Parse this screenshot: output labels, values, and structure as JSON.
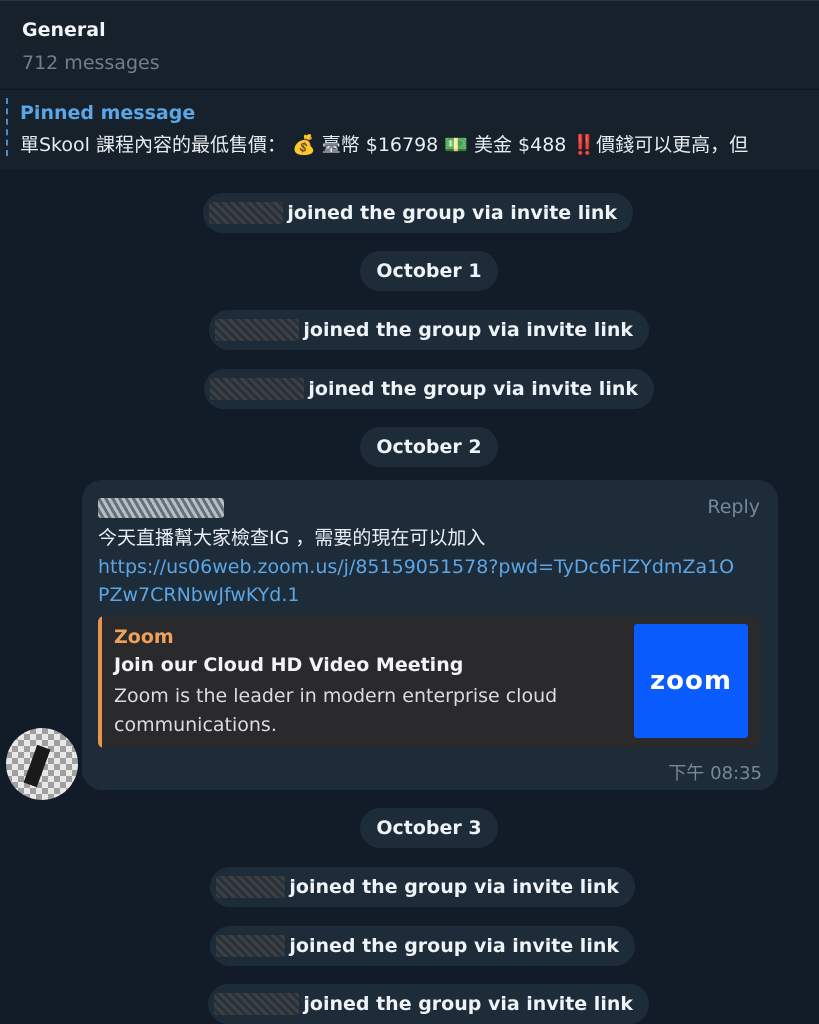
{
  "header": {
    "title": "General",
    "subtitle": "712 messages"
  },
  "pinned": {
    "label": "Pinned message",
    "text": "單Skool 課程內容的最低售價： 💰 臺幣 $16798 💵 美金 $488  ‼️價錢可以更高，但"
  },
  "join_text": "joined the group via invite link",
  "dates": {
    "d1": "October 1",
    "d2": "October 2",
    "d3": "October 3"
  },
  "message": {
    "reply_label": "Reply",
    "text": "今天直播幫大家檢查IG ，需要的現在可以加入",
    "link": "https://us06web.zoom.us/j/85159051578?pwd=TyDc6FlZYdmZa1OPZw7CRNbwJfwKYd.1",
    "time": "下午 08:35",
    "preview": {
      "site": "Zoom",
      "title": "Join our Cloud HD Video Meeting",
      "description": "Zoom is the leader in modern enterprise cloud communications.",
      "thumb_text": "zoom",
      "thumb_color": "#0b5cff"
    }
  },
  "colors": {
    "background": "#121c28",
    "bubble": "#1e2c3a",
    "link": "#5aa6e6",
    "preview_accent": "#e6954a"
  }
}
